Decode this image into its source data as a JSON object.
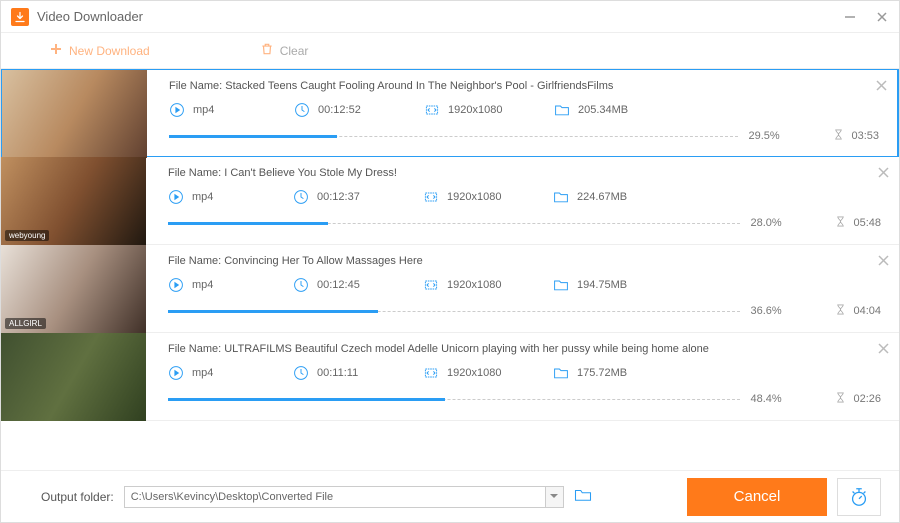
{
  "window": {
    "title": "Video Downloader"
  },
  "toolbar": {
    "new_download": "New Download",
    "clear": "Clear"
  },
  "file_name_prefix": "File Name: ",
  "downloads": [
    {
      "title": "Stacked Teens Caught Fooling Around In The Neighbor's Pool - GirlfriendsFilms",
      "format": "mp4",
      "duration": "00:12:52",
      "resolution": "1920x1080",
      "size": "205.34MB",
      "progress_pct": "29.5%",
      "progress_width": 29.5,
      "time_left": "03:53",
      "active": true,
      "thumb_gradient": "linear-gradient(120deg,#d8c0a0,#b88a60,#604030)",
      "thumb_tag": ""
    },
    {
      "title": "I Can't Believe You Stole My Dress!",
      "format": "mp4",
      "duration": "00:12:37",
      "resolution": "1920x1080",
      "size": "224.67MB",
      "progress_pct": "28.0%",
      "progress_width": 28.0,
      "time_left": "05:48",
      "active": false,
      "thumb_gradient": "linear-gradient(120deg,#c09060,#805030,#201810)",
      "thumb_tag": "webyoung"
    },
    {
      "title": "Convincing Her To Allow Massages Here",
      "format": "mp4",
      "duration": "00:12:45",
      "resolution": "1920x1080",
      "size": "194.75MB",
      "progress_pct": "36.6%",
      "progress_width": 36.6,
      "time_left": "04:04",
      "active": false,
      "thumb_gradient": "linear-gradient(120deg,#e8e0d8,#a89080,#403028)",
      "thumb_tag": "ALLGIRL"
    },
    {
      "title": "ULTRAFILMS Beautiful Czech model Adelle Unicorn playing with her pussy while being home alone",
      "format": "mp4",
      "duration": "00:11:11",
      "resolution": "1920x1080",
      "size": "175.72MB",
      "progress_pct": "48.4%",
      "progress_width": 48.4,
      "time_left": "02:26",
      "active": false,
      "thumb_gradient": "linear-gradient(120deg,#405030,#607040,#304020)",
      "thumb_tag": ""
    }
  ],
  "footer": {
    "label": "Output folder:",
    "path": "C:\\Users\\Kevincy\\Desktop\\Converted File",
    "cancel": "Cancel"
  }
}
